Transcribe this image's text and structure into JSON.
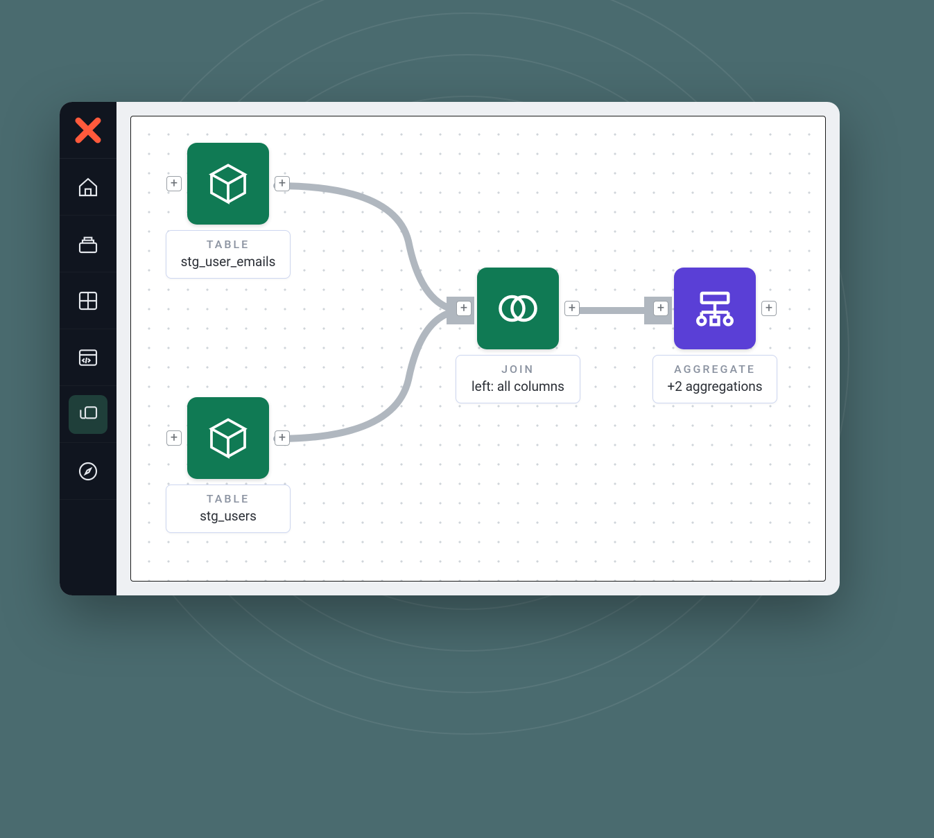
{
  "sidebar": {
    "items": [
      {
        "id": "home"
      },
      {
        "id": "stack"
      },
      {
        "id": "grid"
      },
      {
        "id": "code"
      },
      {
        "id": "copy",
        "active": true
      },
      {
        "id": "compass"
      }
    ]
  },
  "nodes": {
    "emails": {
      "type_label": "TABLE",
      "name": "stg_user_emails"
    },
    "users": {
      "type_label": "TABLE",
      "name": "stg_users"
    },
    "join": {
      "type_label": "JOIN",
      "name": "left: all columns"
    },
    "aggregate": {
      "type_label": "AGGREGATE",
      "name": "+2 aggregations"
    }
  },
  "glyphs": {
    "plus": "+"
  }
}
